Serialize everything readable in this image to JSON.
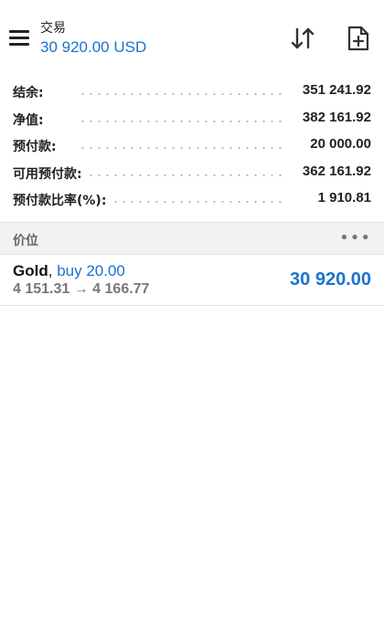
{
  "header": {
    "title": "交易",
    "subtitle": "30 920.00 USD"
  },
  "summary": [
    {
      "label": "结余:",
      "value": "351 241.92"
    },
    {
      "label": "净值:",
      "value": "382 161.92"
    },
    {
      "label": "预付款:",
      "value": "20 000.00"
    },
    {
      "label": "可用预付款:",
      "value": "362 161.92"
    },
    {
      "label": "预付款比率(%):",
      "value": "1 910.81"
    }
  ],
  "positions_section": {
    "label": "价位",
    "more": "•••"
  },
  "position": {
    "symbol": "Gold",
    "separator": ",",
    "direction": "buy 20.00",
    "prices": "4 151.31 → 4 166.77",
    "profit": "30 920.00"
  },
  "colors": {
    "accent": "#1a73d2",
    "text": "#222222",
    "muted": "#777777",
    "section_bg": "#f2f2f2"
  },
  "icons": [
    "menu-icon",
    "sort-icon",
    "new-document-icon",
    "more-icon"
  ]
}
